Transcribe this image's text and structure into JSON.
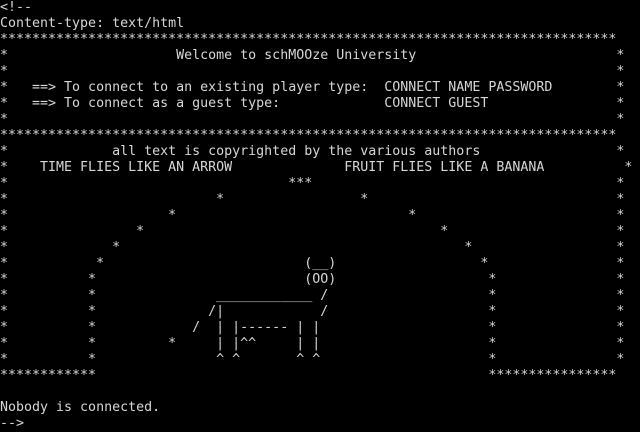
{
  "terminal": {
    "colors": {
      "background": "#000000",
      "foreground": "#d6d6d6"
    },
    "lines": [
      "<!--",
      "Content-type: text/html",
      "*****************************************************************************",
      "*                     Welcome to schMOOze University                         *",
      "*                                                                            *",
      "*   ==> To connect to an existing player type:  CONNECT NAME PASSWORD        *",
      "*   ==> To connect as a guest type:             CONNECT GUEST                *",
      "*                                                                            *",
      "*****************************************************************************",
      "*             all text is copyrighted by the various authors                 *",
      "*    TIME FLIES LIKE AN ARROW              FRUIT FLIES LIKE A BANANA          *",
      "*                                   ***                                      *",
      "*                          *                 *                               *",
      "*                    *                             *                         *",
      "*                *                                     *                     *",
      "*             *                                           *                  *",
      "*           *                         (__)                  *                *",
      "*          *                          (OO)                   *               *",
      "*          *               ____________ /                    *               *",
      "*          *              /|            /                    *               *",
      "*          *            /  | |------ | |                     *               *",
      "*          *         *     | |^^     | |                     *               *",
      "*          *               ^ ^       ^ ^                     *               *",
      "************                                                 ****************",
      "",
      "Nobody is connected.",
      "-->"
    ]
  }
}
